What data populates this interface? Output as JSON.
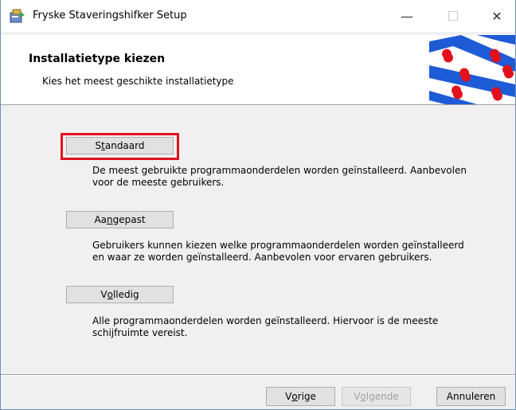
{
  "window": {
    "title": "Fryske Staveringshifker Setup",
    "minimize_glyph": "—",
    "close_glyph": "✕"
  },
  "header": {
    "title": "Installatietype kiezen",
    "subtitle": "Kies het meest geschikte installatietype"
  },
  "options": [
    {
      "label_pre": "S",
      "label_acc": "t",
      "label_post": "andaard",
      "description_line1": "De meest gebruikte programmaonderdelen worden geïnstalleerd. Aanbevolen",
      "description_line2": "voor de meeste gebruikers."
    },
    {
      "label_pre": "Aa",
      "label_acc": "n",
      "label_post": "gepast",
      "description_line1": "Gebruikers kunnen kiezen welke programmaonderdelen worden geïnstalleerd",
      "description_line2": "en waar ze worden geïnstalleerd. Aanbevolen voor ervaren gebruikers."
    },
    {
      "label_pre": "V",
      "label_acc": "o",
      "label_post": "lledig",
      "description_line1": "Alle programmaonderdelen worden geïnstalleerd. Hiervoor is de meeste",
      "description_line2": "schijfruimte vereist."
    }
  ],
  "footer": {
    "back_pre": "V",
    "back_acc": "o",
    "back_post": "rige",
    "next_pre": "V",
    "next_acc": "o",
    "next_post": "lgende",
    "cancel_label": "Annuleren"
  },
  "colors": {
    "focus_highlight": "#e3101d",
    "flag_blue": "#1e5bd6",
    "flag_red": "#e3101d"
  },
  "icons": {
    "app": "installer-icon",
    "flag": "frisian-flag-icon"
  }
}
